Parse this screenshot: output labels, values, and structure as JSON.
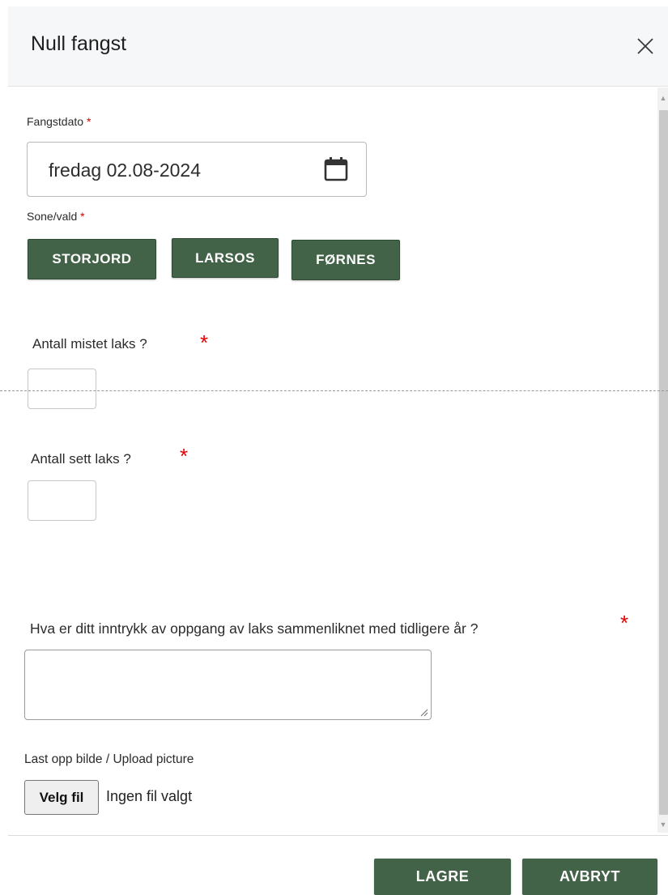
{
  "dialog": {
    "title": "Null fangst",
    "close_icon": "close-icon"
  },
  "form": {
    "date_label": "Fangstdato",
    "date_value": "fredag 02.08-2024",
    "calendar_icon": "calendar-icon",
    "zone_label": "Sone/vald",
    "zones": [
      "STORJORD",
      "LARSOS",
      "FØRNES"
    ],
    "lost_salmon_label": "Antall mistet laks ?",
    "lost_salmon_value": "",
    "seen_salmon_label": "Antall sett laks ?",
    "seen_salmon_value": "",
    "impression_label": "Hva er ditt inntrykk av oppgang av laks sammenliknet med tidligere år ?",
    "impression_value": "",
    "upload_label": "Last opp bilde / Upload picture",
    "upload_button": "Velg fil",
    "upload_status": "Ingen fil valgt",
    "required_marker": "*"
  },
  "footer": {
    "save_label": "LAGRE",
    "cancel_label": "AVBRYT"
  },
  "colors": {
    "button_green": "#426347",
    "required_red": "#d40000"
  }
}
